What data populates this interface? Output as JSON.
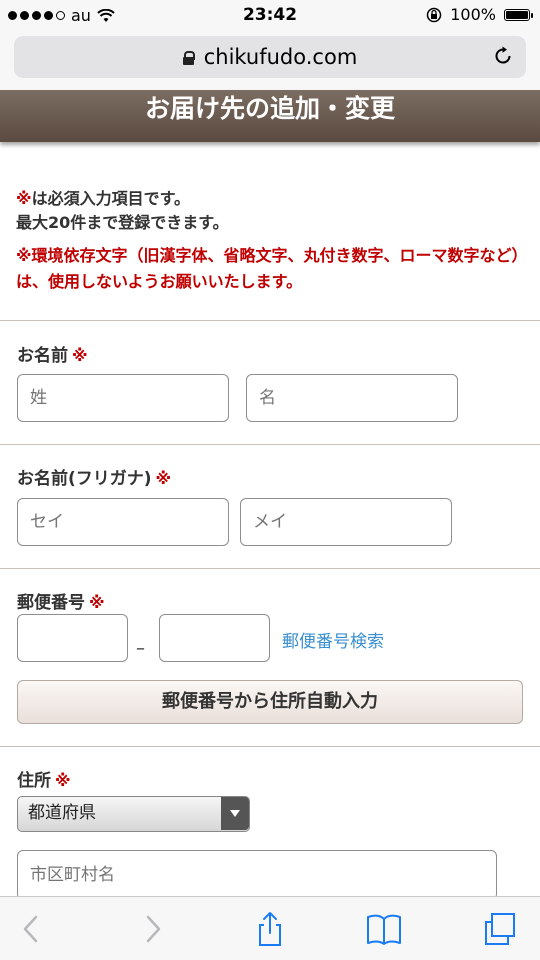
{
  "status_bar": {
    "carrier": "au",
    "time": "23:42",
    "battery": "100%"
  },
  "browser": {
    "url": "chikufudo.com"
  },
  "header": {
    "title": "お届け先の追加・変更"
  },
  "notices": {
    "required_mark": "※",
    "required_text": "は必須入力項目です。",
    "limit_text": "最大20件まで登録できます。",
    "warning": "※環境依存文字（旧漢字体、省略文字、丸付き数字、ローマ数字など）は、使用しないようお願いいたします。"
  },
  "form": {
    "required_mark": "※",
    "name": {
      "label": "お名前",
      "last_placeholder": "姓",
      "first_placeholder": "名"
    },
    "kana": {
      "label": "お名前(フリガナ)",
      "last_placeholder": "セイ",
      "first_placeholder": "メイ"
    },
    "zip": {
      "label": "郵便番号",
      "separator": "–",
      "search_link": "郵便番号検索",
      "auto_fill_button": "郵便番号から住所自動入力"
    },
    "address": {
      "label": "住所",
      "prefecture_selected": "都道府県",
      "city_placeholder": "市区町村名"
    }
  },
  "colors": {
    "required_red": "#c00000",
    "link_blue": "#3a8fd0",
    "header_brown": "#6b5b51"
  }
}
